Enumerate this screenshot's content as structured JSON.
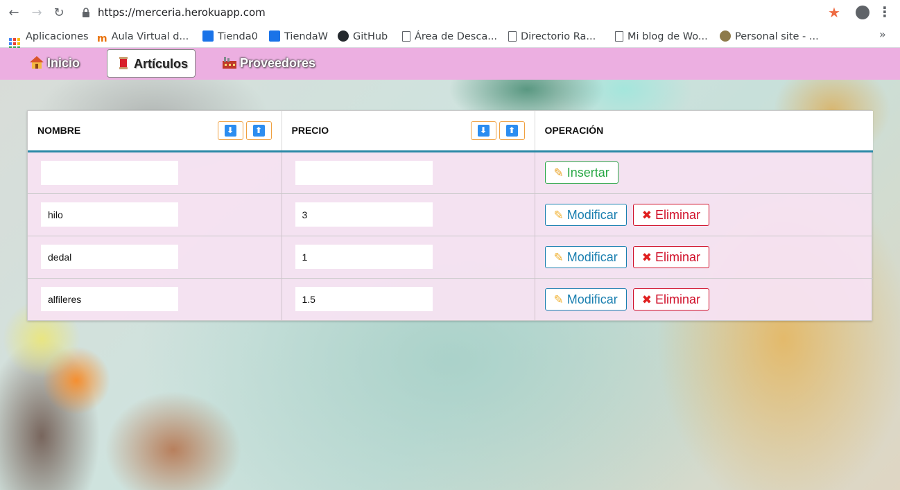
{
  "browser": {
    "url": "https://merceria.herokuapp.com",
    "bookmarks": [
      {
        "label": "Aplicaciones",
        "icon": "apps-grid-icon"
      },
      {
        "label": "Aula Virtual d...",
        "icon": "moodle-icon"
      },
      {
        "label": "Tienda0",
        "icon": "store-icon"
      },
      {
        "label": "TiendaW",
        "icon": "store-icon"
      },
      {
        "label": "GitHub",
        "icon": "github-icon"
      },
      {
        "label": "Área de Desca...",
        "icon": "document-icon"
      },
      {
        "label": "Directorio Ra...",
        "icon": "document-icon"
      },
      {
        "label": "Mi blog de Wo...",
        "icon": "document-icon"
      },
      {
        "label": "Personal site - ...",
        "icon": "site-icon"
      }
    ],
    "more": "»"
  },
  "nav": {
    "items": [
      {
        "label": "Inicio",
        "icon": "house-icon"
      },
      {
        "label": "Artículos",
        "icon": "thread-spool-icon",
        "active": true
      },
      {
        "label": "Proveedores",
        "icon": "factory-icon"
      }
    ]
  },
  "table": {
    "headers": {
      "nombre": "NOMBRE",
      "precio": "PRECIO",
      "operacion": "OPERACIÓN"
    },
    "sort_down": "⬇",
    "sort_up": "⬆",
    "insert_label": "Insertar",
    "modify_label": "Modificar",
    "delete_label": "Eliminar",
    "new_row": {
      "nombre": "",
      "precio": ""
    },
    "rows": [
      {
        "nombre": "hilo",
        "precio": "3"
      },
      {
        "nombre": "dedal",
        "precio": "1"
      },
      {
        "nombre": "alfileres",
        "precio": "1.5"
      }
    ]
  },
  "colors": {
    "nav_bg": "#ecafe1",
    "header_border": "#2a88a6",
    "insert": "#28a745",
    "modify": "#1a7fb0",
    "delete": "#d0102a"
  }
}
